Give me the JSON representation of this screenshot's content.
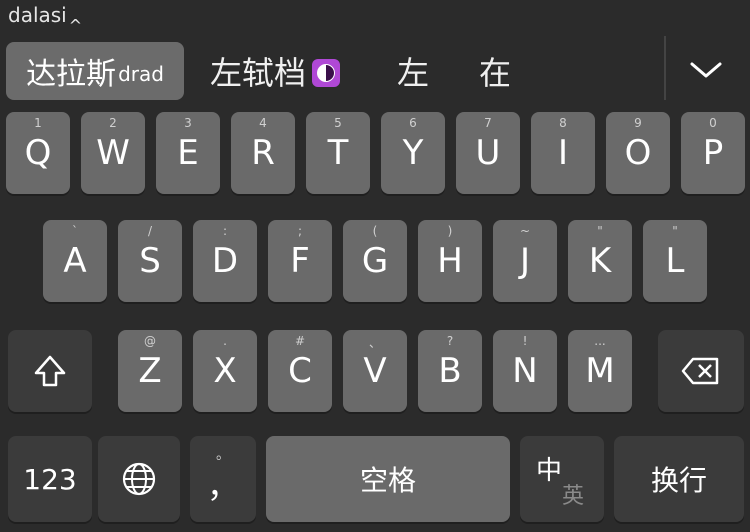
{
  "composing": {
    "text": "dalasi",
    "caret": "^"
  },
  "candidates": {
    "first": {
      "main": "达拉斯",
      "sub": "drad"
    },
    "items": [
      {
        "text": "左轼档",
        "has_icon": true
      },
      {
        "text": "左"
      },
      {
        "text": "在"
      }
    ]
  },
  "rows": {
    "row1": [
      {
        "label": "Q",
        "hint": "1"
      },
      {
        "label": "W",
        "hint": "2"
      },
      {
        "label": "E",
        "hint": "3"
      },
      {
        "label": "R",
        "hint": "4"
      },
      {
        "label": "T",
        "hint": "5"
      },
      {
        "label": "Y",
        "hint": "6"
      },
      {
        "label": "U",
        "hint": "7"
      },
      {
        "label": "I",
        "hint": "8"
      },
      {
        "label": "O",
        "hint": "9"
      },
      {
        "label": "P",
        "hint": "0"
      }
    ],
    "row2": [
      {
        "label": "A",
        "hint": "`"
      },
      {
        "label": "S",
        "hint": "/"
      },
      {
        "label": "D",
        "hint": ":"
      },
      {
        "label": "F",
        "hint": ";"
      },
      {
        "label": "G",
        "hint": "("
      },
      {
        "label": "H",
        "hint": ")"
      },
      {
        "label": "J",
        "hint": "~"
      },
      {
        "label": "K",
        "hint": "\""
      },
      {
        "label": "L",
        "hint": "\""
      }
    ],
    "row3": [
      {
        "label": "Z",
        "hint": "@"
      },
      {
        "label": "X",
        "hint": "."
      },
      {
        "label": "C",
        "hint": "#"
      },
      {
        "label": "V",
        "hint": "、"
      },
      {
        "label": "B",
        "hint": "?"
      },
      {
        "label": "N",
        "hint": "!"
      },
      {
        "label": "M",
        "hint": "..."
      }
    ]
  },
  "bottom": {
    "numbers": "123",
    "comma": "，",
    "comma_hint": "。",
    "space": "空格",
    "lang_top": "中",
    "lang_bottom": "英",
    "enter": "换行"
  }
}
